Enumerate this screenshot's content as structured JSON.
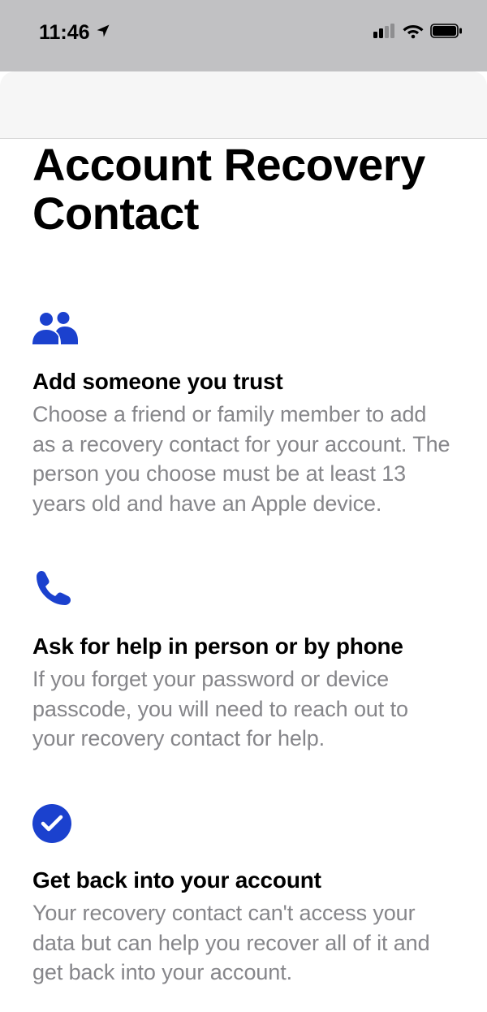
{
  "status_bar": {
    "time": "11:46"
  },
  "page": {
    "title": "Account Recovery Contact"
  },
  "features": [
    {
      "title": "Add someone you trust",
      "body": "Choose a friend or family member to add as a recovery contact for your account. The person you choose must be at least 13 years old and have an Apple device."
    },
    {
      "title": "Ask for help in person or by phone",
      "body": "If you forget your password or device passcode, you will need to reach out to your recovery contact for help."
    },
    {
      "title": "Get back into your account",
      "body": "Your recovery contact can't access your data but can help you recover all of it and get back into your account."
    }
  ]
}
